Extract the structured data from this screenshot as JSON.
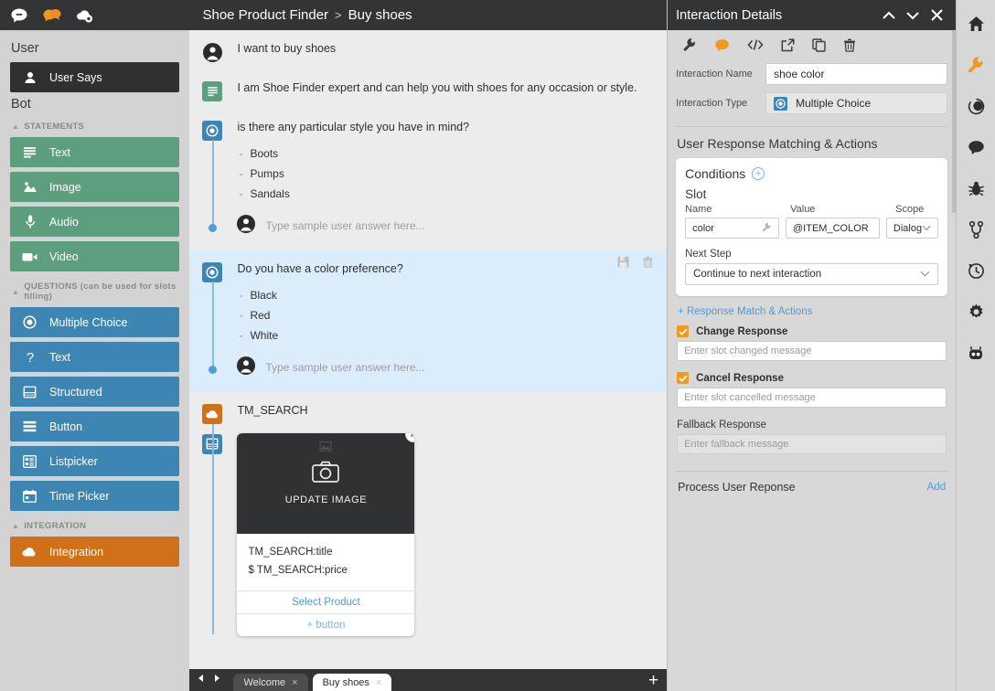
{
  "app": {
    "top_icons": [
      {
        "name": "chat-bubble-icon",
        "label": "Chat"
      },
      {
        "name": "conversations-icon",
        "label": "Conversations"
      },
      {
        "name": "cloud-settings-icon",
        "label": "Cloud Settings"
      }
    ]
  },
  "sidebar": {
    "user_group_title": "User",
    "user_item": {
      "label": "User Says",
      "icon": "person-icon"
    },
    "bot_group_title": "Bot",
    "statements_header": "STATEMENTS",
    "statements": [
      {
        "label": "Text",
        "icon": "text-lines-icon",
        "color": "#5c9e7d"
      },
      {
        "label": "Image",
        "icon": "image-icon",
        "color": "#5c9e7d"
      },
      {
        "label": "Audio",
        "icon": "microphone-icon",
        "color": "#5c9e7d"
      },
      {
        "label": "Video",
        "icon": "video-camera-icon",
        "color": "#5c9e7d"
      }
    ],
    "questions_header": "QUESTIONS (can be used for slots filling)",
    "questions": [
      {
        "label": "Multiple Choice",
        "icon": "radio-button-icon",
        "color": "#3d86b4"
      },
      {
        "label": "Text",
        "icon": "question-mark-icon",
        "color": "#3d86b4"
      },
      {
        "label": "Structured",
        "icon": "structured-card-icon",
        "color": "#3d86b4"
      },
      {
        "label": "Button",
        "icon": "button-list-icon",
        "color": "#3d86b4"
      },
      {
        "label": "Listpicker",
        "icon": "listpicker-icon",
        "color": "#3d86b4"
      },
      {
        "label": "Time Picker",
        "icon": "calendar-icon",
        "color": "#3d86b4"
      }
    ],
    "integration_header": "INTEGRATION",
    "integration": [
      {
        "label": "Integration",
        "icon": "cloud-icon",
        "color": "#d0711a"
      }
    ]
  },
  "center": {
    "breadcrumb": {
      "root": "Shoe Product Finder",
      "separator": ">",
      "current": "Buy shoes"
    },
    "flow": [
      {
        "type": "user",
        "icon": "avatar-icon",
        "text": "I want to buy shoes"
      },
      {
        "type": "statement-text",
        "icon": "text-lines-icon",
        "text": "I am Shoe Finder expert and can help you with shoes for any occasion or style."
      },
      {
        "type": "multiple-choice",
        "icon": "radio-button-icon",
        "text": "is there any particular style you have in mind?",
        "choices": [
          "Boots",
          "Pumps",
          "Sandals"
        ],
        "answer_placeholder": "Type sample user answer here...",
        "selected": false
      },
      {
        "type": "multiple-choice",
        "icon": "radio-button-icon",
        "text": "Do you have a color preference?",
        "choices": [
          "Black",
          "Red",
          "White"
        ],
        "answer_placeholder": "Type sample user answer here...",
        "selected": true,
        "tools": [
          "save-icon",
          "trash-icon"
        ]
      },
      {
        "type": "integration",
        "icon": "cloud-icon",
        "text": "TM_SEARCH"
      }
    ],
    "card": {
      "icon": "structured-card-icon",
      "image_placeholder_label": "UPDATE IMAGE",
      "image_icon": "camera-icon",
      "close_icon": "close-icon",
      "title": "TM_SEARCH:title",
      "price": "$ TM_SEARCH:price",
      "buttons": [
        {
          "label": "Select Product",
          "muted": false
        },
        {
          "label": "+ button",
          "muted": true
        }
      ]
    },
    "tabbar": {
      "prev_icon": "chevron-left-icon",
      "next_icon": "chevron-right-icon",
      "tabs": [
        {
          "label": "Welcome",
          "active": false,
          "close": "×"
        },
        {
          "label": "Buy shoes",
          "active": true,
          "close": "×"
        }
      ],
      "add_label": "+"
    }
  },
  "right_panel": {
    "title": "Interaction Details",
    "header_icons": [
      {
        "name": "chevron-up-icon"
      },
      {
        "name": "chevron-down-icon"
      },
      {
        "name": "close-icon"
      }
    ],
    "toolbar": [
      {
        "name": "wrench-icon"
      },
      {
        "name": "chat-bubble-icon",
        "color": "#f2981d"
      },
      {
        "name": "code-icon"
      },
      {
        "name": "external-link-icon"
      },
      {
        "name": "copy-icon"
      },
      {
        "name": "trash-icon"
      }
    ],
    "interaction_name_label": "Interaction Name",
    "interaction_name_value": "shoe color",
    "interaction_type_label": "Interaction Type",
    "interaction_type_value": "Multiple Choice",
    "interaction_type_icon": "radio-button-icon",
    "matching_section_title": "User Response Matching & Actions",
    "conditions": {
      "title": "Conditions",
      "add_icon": "plus-circle-icon",
      "slot_label": "Slot",
      "columns": [
        "Name",
        "Value",
        "Scope"
      ],
      "row": {
        "name": "color",
        "name_icon": "wrench-icon",
        "value": "@ITEM_COLOR",
        "scope": "Dialog"
      },
      "next_step_label": "Next Step",
      "next_step_value": "Continue to next interaction"
    },
    "add_response_link": "+ Response Match & Actions",
    "change_response": {
      "label": "Change Response",
      "checked": true,
      "placeholder": "Enter slot changed message"
    },
    "cancel_response": {
      "label": "Cancel Response",
      "checked": true,
      "placeholder": "Enter slot cancelled message"
    },
    "fallback_response": {
      "label": "Fallback Response",
      "placeholder": "Enter fallback message"
    },
    "process_user_response": {
      "label": "Process User Reponse",
      "add_label": "Add"
    }
  },
  "rail": {
    "icons": [
      {
        "name": "home-icon",
        "active": false
      },
      {
        "name": "wrench-icon",
        "active": true,
        "color": "#f2981d"
      },
      {
        "name": "nlu-circle-icon",
        "active": false
      },
      {
        "name": "chat-bubble-icon",
        "active": false
      },
      {
        "name": "bug-icon",
        "active": false
      },
      {
        "name": "branch-icon",
        "active": false
      },
      {
        "name": "history-clock-icon",
        "active": false
      },
      {
        "name": "gear-icon",
        "active": false
      },
      {
        "name": "robot-icon",
        "active": false
      }
    ]
  },
  "colors": {
    "dark_chrome": "#333436",
    "accent_orange": "#f2981d",
    "accent_blue": "#4f9ad8",
    "statement_green": "#5c9e7d",
    "question_blue": "#3d86b4",
    "integration_orange": "#d0711a",
    "selected_row": "#dbecfb"
  }
}
